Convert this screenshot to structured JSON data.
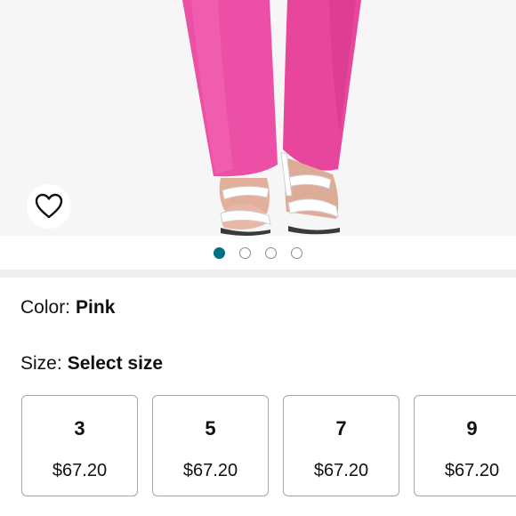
{
  "product": {
    "dots": [
      {
        "active": true
      },
      {
        "active": false
      },
      {
        "active": false
      },
      {
        "active": false
      }
    ]
  },
  "variations": {
    "color_label": "Color:",
    "color_value": "Pink",
    "size_label": "Size:",
    "size_value": "Select size"
  },
  "sizes": [
    {
      "size": "3",
      "price": "$67.20"
    },
    {
      "size": "5",
      "price": "$67.20"
    },
    {
      "size": "7",
      "price": "$67.20"
    },
    {
      "size": "9",
      "price": "$67.20"
    }
  ],
  "icons": {
    "wishlist": "heart-outline-icon"
  },
  "colors": {
    "accent": "#007185",
    "pants": "#ec4fa6",
    "text": "#0f1111",
    "tile_border": "#a6a6a6"
  }
}
